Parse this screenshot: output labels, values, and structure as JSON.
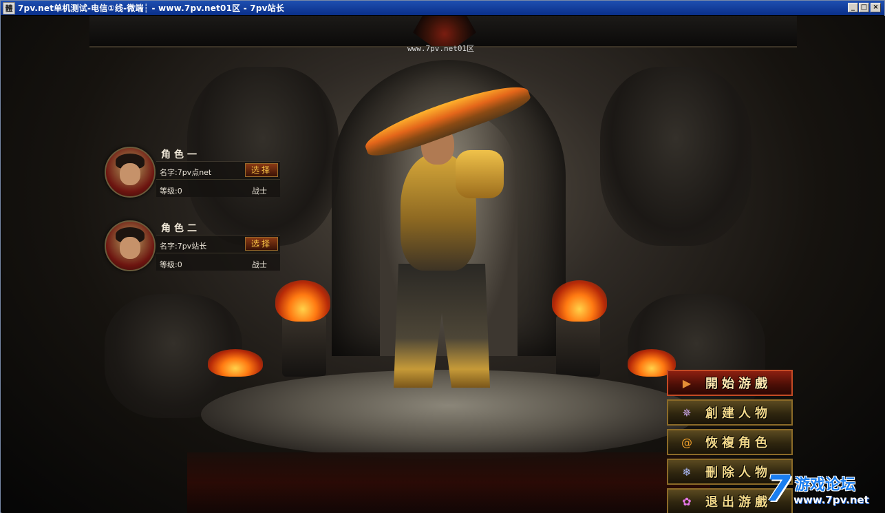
{
  "window": {
    "title": "7pv.net单机测试-电信①线-微端┆ - www.7pv.net01区 - 7pv站长",
    "app_icon": "體",
    "min": "_",
    "max": "□",
    "close": "×"
  },
  "server_label": "www.7pv.net01区",
  "characters": [
    {
      "title": "角色一",
      "name": "名字:7pv点net",
      "level": "等级:0",
      "class": "战士",
      "select": "选择"
    },
    {
      "title": "角色二",
      "name": "名字:7pv站长",
      "level": "等级:0",
      "class": "战士",
      "select": "选择"
    }
  ],
  "menu": {
    "start": "開始游戲",
    "create": "創建人物",
    "restore": "恢複角色",
    "delete": "刪除人物",
    "exit": "退出游戲"
  },
  "icons": {
    "start": "play-icon",
    "create": "star-icon",
    "restore": "spiral-icon",
    "delete": "snowflake-icon",
    "exit": "flower-icon"
  },
  "watermark": {
    "seven": "7",
    "forum": "游戏论坛",
    "url": "www.7pv.net"
  },
  "colors": {
    "titlebar": "#0a2f8a",
    "menu_text": "#f3d98a",
    "start_button": "#8c1f10",
    "watermark_blue": "#1a7ef0"
  }
}
